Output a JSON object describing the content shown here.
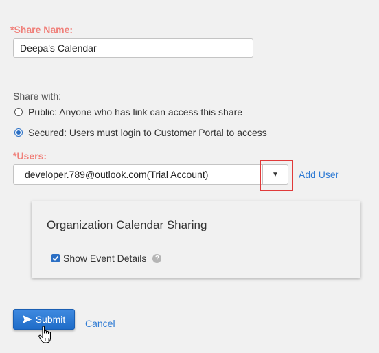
{
  "form": {
    "share_name_label": "*Share Name:",
    "share_name_value": "Deepa's Calendar",
    "share_with_label": "Share with:",
    "options": [
      {
        "label": "Public: Anyone who has link can access this share",
        "checked": false
      },
      {
        "label": "Secured: Users must login to Customer Portal to access",
        "checked": true
      }
    ],
    "users_label": "*Users:",
    "users_value": "developer.789@outlook.com(Trial Account)",
    "dropdown_glyph": "▼",
    "add_user_label": "Add User"
  },
  "card": {
    "title": "Organization Calendar Sharing",
    "show_event_details_label": "Show Event Details",
    "show_event_details_checked": true,
    "help_glyph": "?"
  },
  "actions": {
    "submit_label": "Submit",
    "cancel_label": "Cancel"
  },
  "colors": {
    "required_label": "#f0807a",
    "link": "#2f7bd4",
    "primary_button": "#2b77d2",
    "highlight": "#e03a3a",
    "background": "#f1f1f1"
  },
  "icons": {
    "submit": "send-icon",
    "cursor": "hand-pointer-icon",
    "help": "help-icon",
    "dropdown": "caret-down-icon"
  }
}
